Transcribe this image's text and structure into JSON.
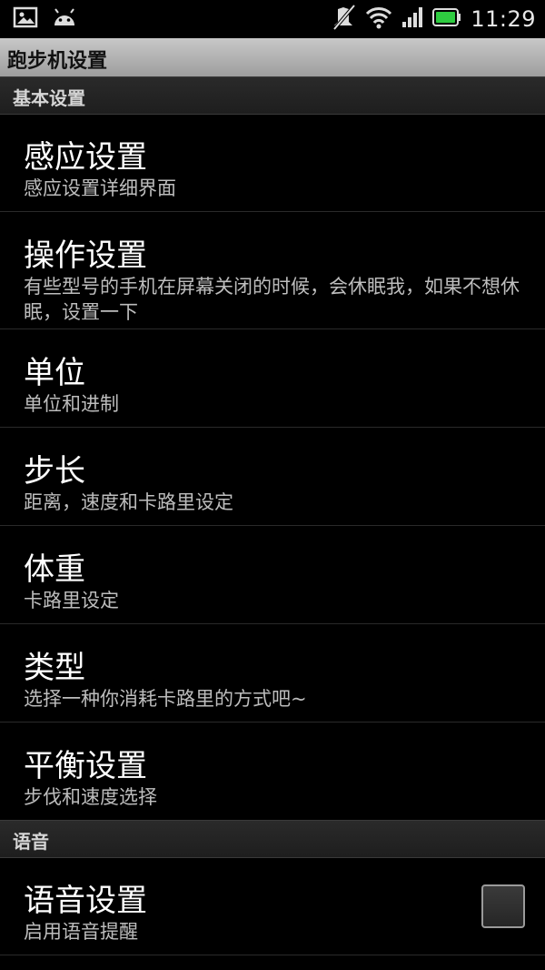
{
  "status_bar": {
    "left_icons": [
      "image-icon",
      "android-icon"
    ],
    "right_icons": [
      "mute-icon",
      "wifi-icon",
      "signal-icon",
      "battery-icon"
    ],
    "time": "11:29",
    "battery_color": "#2ecc40"
  },
  "app_title": "跑步机设置",
  "categories": [
    {
      "title": "基本设置",
      "items": [
        {
          "title": "感应设置",
          "subtitle": "感应设置详细界面"
        },
        {
          "title": "操作设置",
          "subtitle": "有些型号的手机在屏幕关闭的时候，会休眠我，如果不想休眠，设置一下"
        },
        {
          "title": "单位",
          "subtitle": "单位和进制"
        },
        {
          "title": "步长",
          "subtitle": "距离，速度和卡路里设定"
        },
        {
          "title": "体重",
          "subtitle": "卡路里设定"
        },
        {
          "title": "类型",
          "subtitle": "选择一种你消耗卡路里的方式吧~"
        },
        {
          "title": "平衡设置",
          "subtitle": "步伐和速度选择"
        }
      ]
    },
    {
      "title": "语音",
      "items": [
        {
          "title": "语音设置",
          "subtitle": "启用语音提醒",
          "checkbox": false
        }
      ]
    }
  ]
}
